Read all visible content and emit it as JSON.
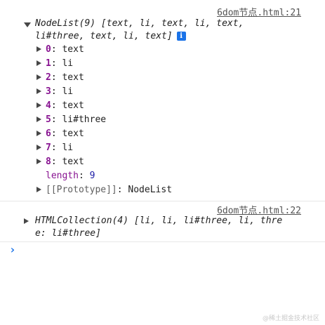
{
  "entries": [
    {
      "source": "6dom节点.html:21",
      "summary_line1": "NodeList(9) [text, li, text, li, text,",
      "summary_line2": "li#three, text, li, text]",
      "info_badge": "i",
      "properties": [
        {
          "key": "0",
          "value": "text"
        },
        {
          "key": "1",
          "value": "li"
        },
        {
          "key": "2",
          "value": "text"
        },
        {
          "key": "3",
          "value": "li"
        },
        {
          "key": "4",
          "value": "text"
        },
        {
          "key": "5",
          "value": "li#three"
        },
        {
          "key": "6",
          "value": "text"
        },
        {
          "key": "7",
          "value": "li"
        },
        {
          "key": "8",
          "value": "text"
        }
      ],
      "length_key": "length",
      "length_value": "9",
      "prototype_key": "[[Prototype]]",
      "prototype_value": "NodeList"
    },
    {
      "source": "6dom节点.html:22",
      "summary_line1": "HTMLCollection(4) [li, li, li#three, li, thre",
      "summary_line2": "e: li#three]"
    }
  ],
  "prompt_symbol": "›",
  "watermark": "@稀土掘金技术社区",
  "colors": {
    "accent": "#1a73e8",
    "property_key": "#881391",
    "number": "#1a1aa6"
  }
}
